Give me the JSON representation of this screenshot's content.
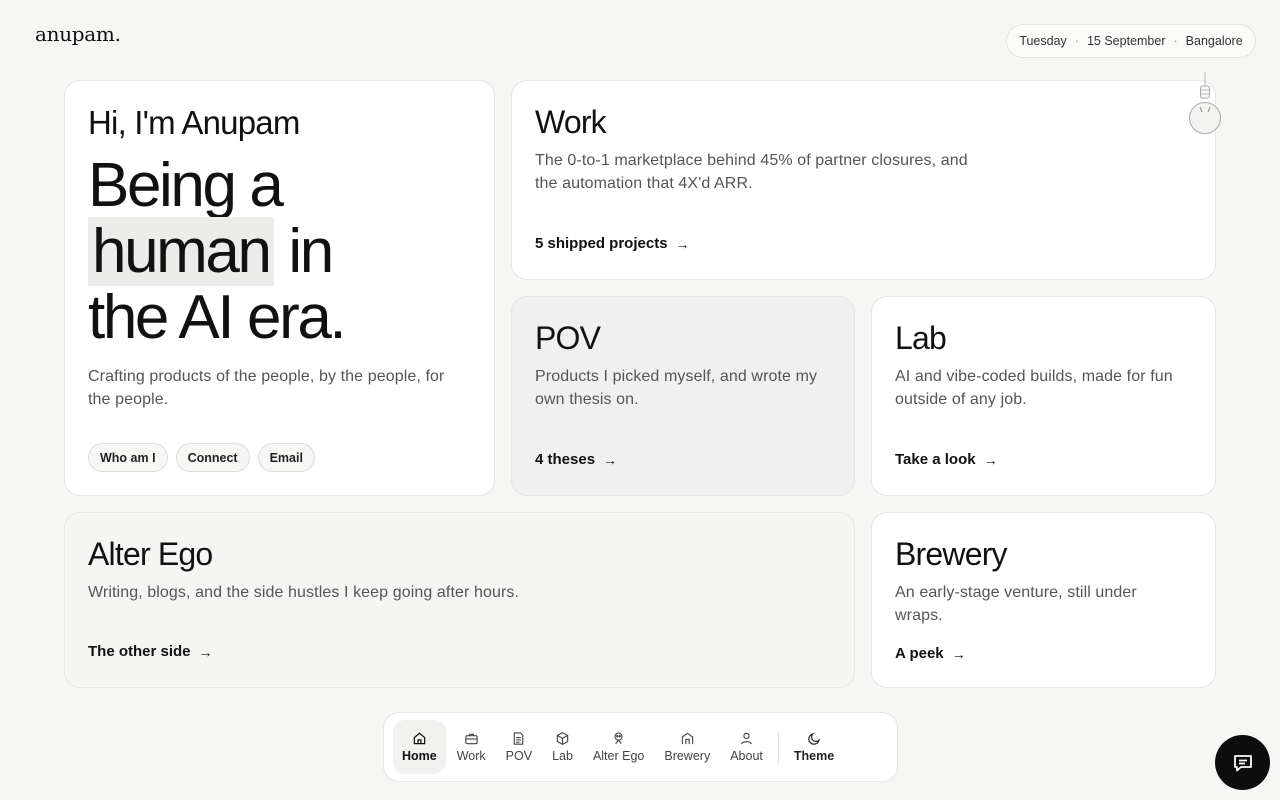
{
  "brand": {
    "logo": "anupam."
  },
  "header": {
    "day": "Tuesday",
    "date": "15 September",
    "city": "Bangalore",
    "separator": "·"
  },
  "hero": {
    "greeting": "Hi, I'm Anupam",
    "headline_1": "Being a",
    "headline_2a": "human",
    "headline_2b": " in",
    "headline_3": "the AI era.",
    "description": "Crafting products of the people, by the people, for the people.",
    "chips": [
      "Who am I",
      "Connect",
      "Email"
    ]
  },
  "work": {
    "title": "Work",
    "description": "The 0-to-1 marketplace behind 45% of partner closures, and the automation that 4X'd ARR.",
    "cta": "5 shipped projects"
  },
  "pov": {
    "title": "POV",
    "description": "Products I picked myself, and wrote my own thesis on.",
    "cta": "4 theses"
  },
  "lab": {
    "title": "Lab",
    "description": "AI and vibe-coded builds, made for fun outside of any job.",
    "cta": "Take a look"
  },
  "alter_ego": {
    "title": "Alter Ego",
    "description": "Writing, blogs, and the side hustles I keep going after hours.",
    "cta": "The other side"
  },
  "brewery": {
    "title": "Brewery",
    "description": "An early-stage venture, still under wraps.",
    "cta": "A peek"
  },
  "nav": {
    "items": [
      {
        "label": "Home",
        "icon": "home-icon"
      },
      {
        "label": "Work",
        "icon": "briefcase-icon"
      },
      {
        "label": "POV",
        "icon": "document-icon"
      },
      {
        "label": "Lab",
        "icon": "cube-icon"
      },
      {
        "label": "Alter Ego",
        "icon": "mask-icon"
      },
      {
        "label": "Brewery",
        "icon": "building-icon"
      },
      {
        "label": "About",
        "icon": "user-icon"
      }
    ],
    "theme_label": "Theme",
    "active": "Home"
  },
  "arrow": "→",
  "colors": {
    "background": "#f6f6f5",
    "card": "#ffffff",
    "accent_dark": "#0d0d0d"
  }
}
